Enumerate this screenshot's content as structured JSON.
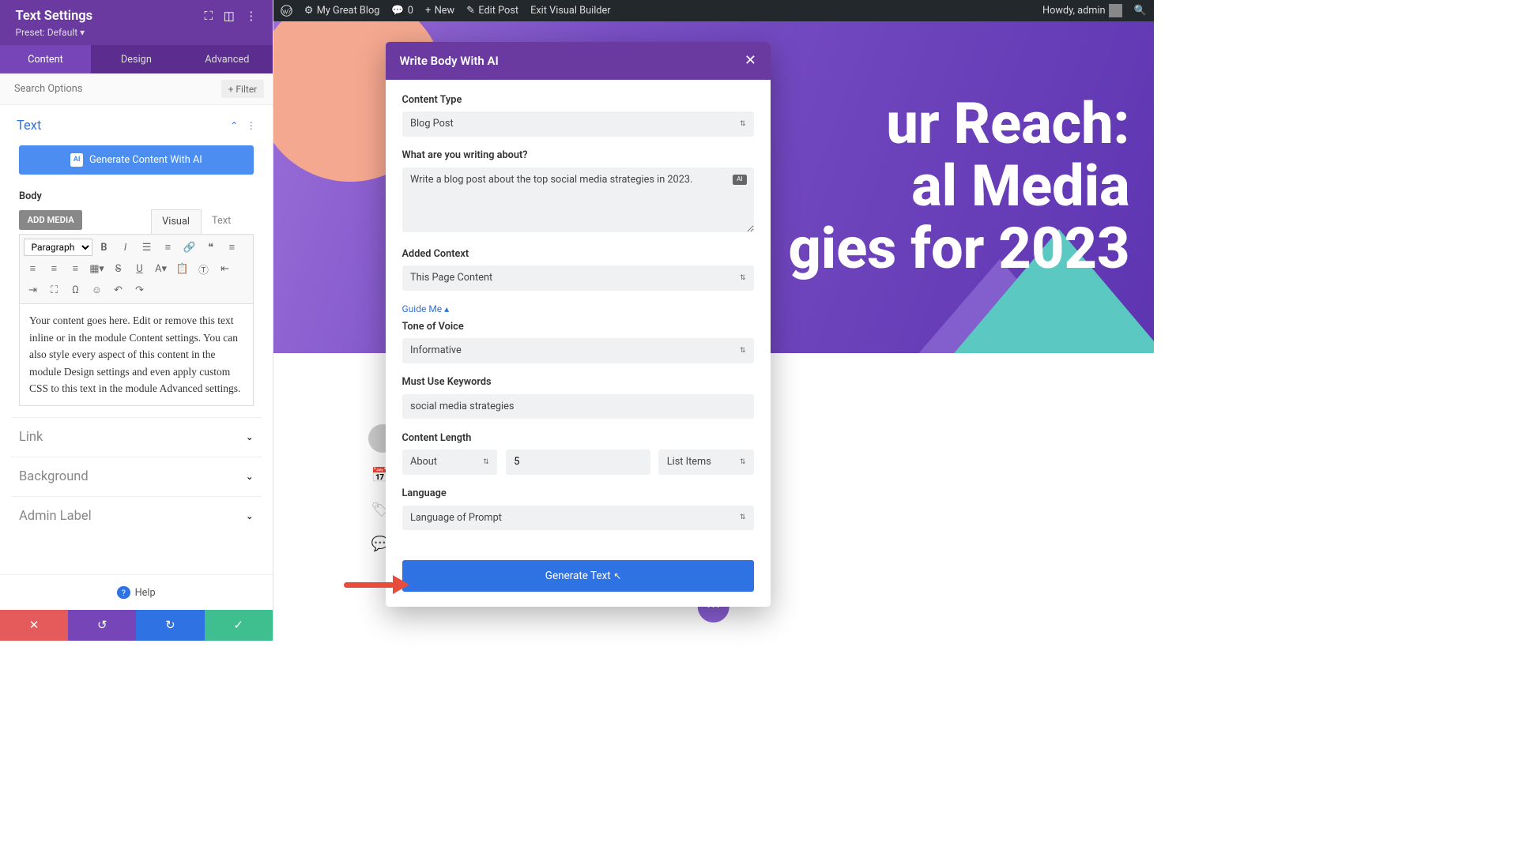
{
  "wpbar": {
    "site": "My Great Blog",
    "comments": "0",
    "new": "New",
    "edit": "Edit Post",
    "exit": "Exit Visual Builder",
    "howdy": "Howdy, admin"
  },
  "sidebar": {
    "title": "Text Settings",
    "preset": "Preset: Default ▾",
    "tabs": [
      "Content",
      "Design",
      "Advanced"
    ],
    "search_ph": "Search Options",
    "filter": "Filter",
    "section_text": "Text",
    "ai_btn": "Generate Content With AI",
    "body_label": "Body",
    "add_media": "ADD MEDIA",
    "editor_tabs": [
      "Visual",
      "Text"
    ],
    "para": "Paragraph",
    "content": "Your content goes here. Edit or remove this text inline or in the module Content settings. You can also style every aspect of this content in the module Design settings and even apply custom CSS to this text in the module Advanced settings.",
    "sections": [
      "Link",
      "Background",
      "Admin Label"
    ],
    "help": "Help"
  },
  "hero": {
    "line1": "ur Reach:",
    "line2": "al Media",
    "line3": "gies for 2023"
  },
  "modal": {
    "title": "Write Body With AI",
    "content_type_lbl": "Content Type",
    "content_type": "Blog Post",
    "about_lbl": "What are you writing about?",
    "about_val": "Write a blog post about the top social media strategies in 2023.",
    "context_lbl": "Added Context",
    "context": "This Page Content",
    "guide": "Guide Me  ▴",
    "tone_lbl": "Tone of Voice",
    "tone": "Informative",
    "keywords_lbl": "Must Use Keywords",
    "keywords": "social media strategies",
    "length_lbl": "Content Length",
    "length_mode": "About",
    "length_val": "5",
    "length_unit": "List Items",
    "lang_lbl": "Language",
    "lang": "Language of Prompt",
    "generate": "Generate Text"
  }
}
